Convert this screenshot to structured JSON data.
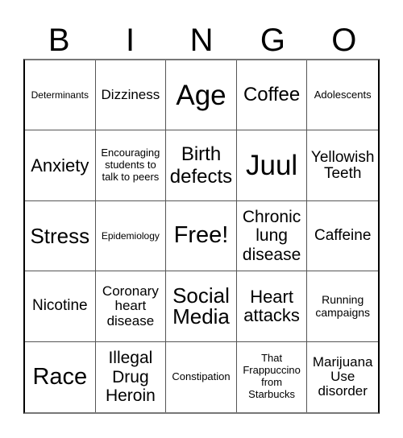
{
  "header": {
    "letters": [
      "B",
      "I",
      "N",
      "G",
      "O"
    ]
  },
  "card": {
    "cells": [
      "Determinants",
      "Dizziness",
      "Age",
      "Coffee",
      "Adolescents",
      "Anxiety",
      "Encouraging\nstudents to\ntalk to peers",
      "Birth\ndefects",
      "Juul",
      "Yellowish\nTeeth",
      "Stress",
      "Epidemiology",
      "Free!",
      "Chronic\nlung\ndisease",
      "Caffeine",
      "Nicotine",
      "Coronary\nheart\ndisease",
      "Social\nMedia",
      "Heart\nattacks",
      "Running\ncampaigns",
      "Race",
      "Illegal\nDrug\nHeroin",
      "Constipation",
      "That\nFrappuccino\nfrom\nStarbucks",
      "Marijuana\nUse\ndisorder"
    ]
  }
}
